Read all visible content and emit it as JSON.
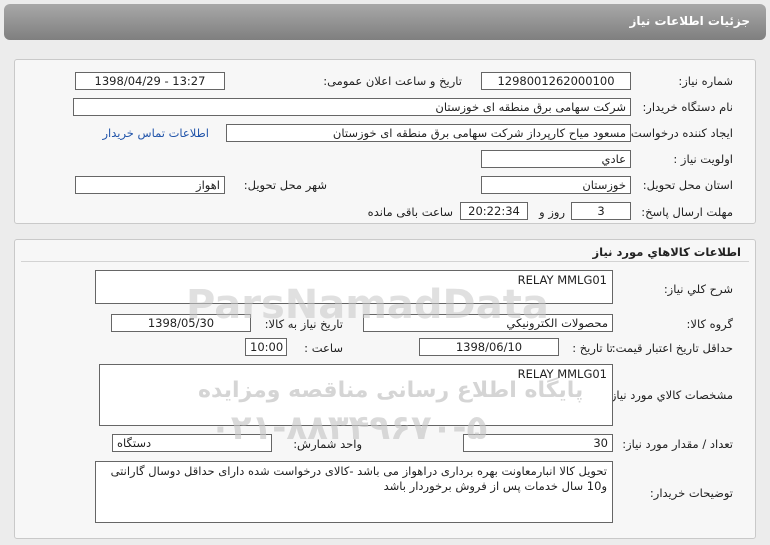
{
  "header": {
    "title": "جزئیات اطلاعات نیاز"
  },
  "need_info": {
    "need_number_label": "شماره نیاز:",
    "need_number": "1298001262000100",
    "announce_label": "تاریخ و ساعت اعلان عمومی:",
    "announce_value": "1398/04/29 - 13:27",
    "buyer_label": "نام دستگاه خریدار:",
    "buyer_value": "شرکت سهامی برق منطقه ای خوزستان",
    "creator_label": "ایجاد کننده درخواست:",
    "creator_value": "مسعود میاح کارپرداز شرکت سهامی برق منطقه ای خوزستان",
    "contact_link": "اطلاعات تماس خریدار",
    "priority_label": "اولویت نیاز :",
    "priority_value": "عادي",
    "province_label": "استان محل تحویل:",
    "province_value": "خوزستان",
    "city_label": "شهر محل تحویل:",
    "city_value": "اهواز",
    "deadline_label": "مهلت ارسال پاسخ:",
    "days_value": "3",
    "days_suffix": "روز و",
    "time_value": "20:22:34",
    "remaining_suffix": "ساعت باقی مانده"
  },
  "goods": {
    "section_title": "اطلاعات کالاهاي مورد نیاز",
    "summary_label": "شرح کلي نیاز:",
    "summary_value": "RELAY MMLG01",
    "group_label": "گروه کالا:",
    "group_value": "محصولات الکترونیکي",
    "need_date_label": "تاریخ نیاز به کالا:",
    "need_date_value": "1398/05/30",
    "validity_label": "حداقل تاریخ اعتبار قیمت:",
    "until_date_label": "تا تاریخ :",
    "until_date_value": "1398/06/10",
    "hour_label": "ساعت :",
    "hour_value": "10:00",
    "spec_label": "مشخصات کالاي مورد نیاز:",
    "spec_value": "RELAY MMLG01",
    "qty_label": "تعداد / مقدار مورد نیاز:",
    "qty_value": "30",
    "unit_label": "واحد شمارش:",
    "unit_value": "دستگاه",
    "desc_label": "توضیحات خریدار:",
    "desc_value": "تحویل کالا انبارمعاونت بهره برداری دراهواز می باشد -کالای درخواست شده دارای حداقل دوسال گارانتی و10 سال خدمات پس از فروش برخوردار باشد"
  },
  "watermark": {
    "line1": "ParsNamadData",
    "line2": "پایگاه اطلاع رسانی مناقصه ومزایده",
    "line3": "۰۲۱-۸۸۳۴۹۶۷۰-۵"
  }
}
